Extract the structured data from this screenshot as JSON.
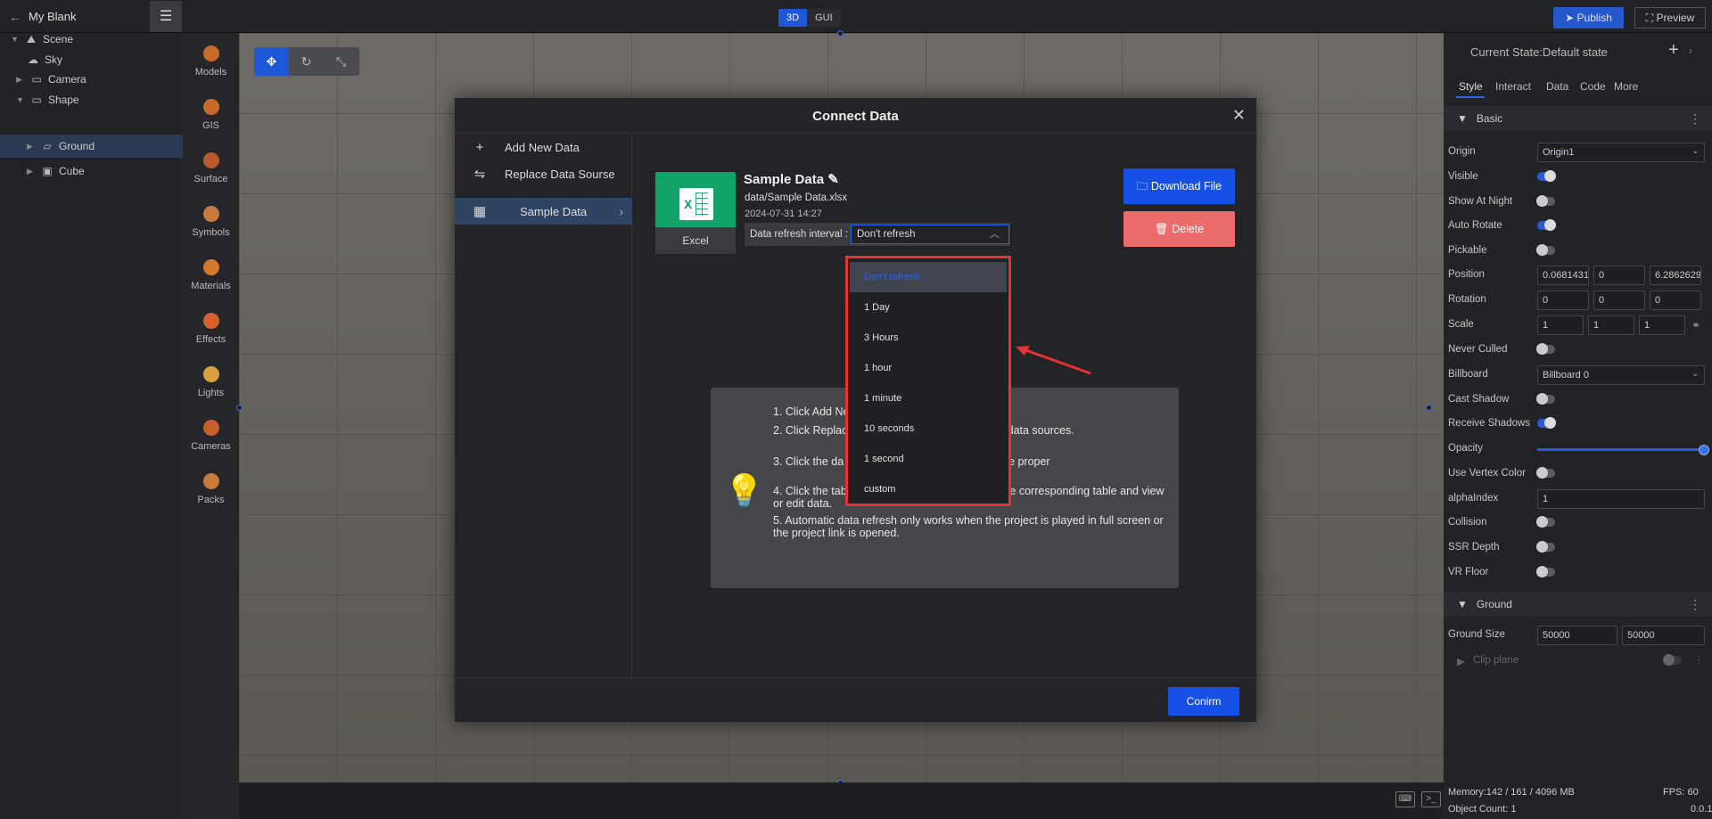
{
  "topbar": {
    "project_name": "My Blank",
    "modes": [
      "3D",
      "GUI"
    ],
    "publish_label": "Publish",
    "preview_label": "Preview"
  },
  "scene_tree": {
    "items": [
      {
        "label": "Scene"
      },
      {
        "label": "Sky"
      },
      {
        "label": "Camera"
      },
      {
        "label": "Shape"
      },
      {
        "label": "Ground"
      },
      {
        "label": "Cube"
      }
    ]
  },
  "toolbox": {
    "items": [
      {
        "label": "Models",
        "color": "#c86a2c"
      },
      {
        "label": "GIS",
        "color": "#c86a2c"
      },
      {
        "label": "Surface",
        "color": "#b85a2c"
      },
      {
        "label": "Symbols",
        "color": "#c87a3c"
      },
      {
        "label": "Materials",
        "color": "#d0782c"
      },
      {
        "label": "Effects",
        "color": "#d8602c"
      },
      {
        "label": "Lights",
        "color": "#d8a040"
      },
      {
        "label": "Cameras",
        "color": "#c8602c"
      },
      {
        "label": "Packs",
        "color": "#c87a3c"
      }
    ]
  },
  "properties": {
    "current_state": "Current State:Default state",
    "tabs": [
      "Style",
      "Interact",
      "Data",
      "Code",
      "More"
    ],
    "basic_title": "Basic",
    "rows": {
      "origin": {
        "label": "Origin",
        "value": "Origin1"
      },
      "visible": {
        "label": "Visible",
        "on": true
      },
      "show_at_night": {
        "label": "Show At Night",
        "on": false
      },
      "auto_rotate": {
        "label": "Auto Rotate",
        "on": true
      },
      "pickable": {
        "label": "Pickable",
        "on": false
      },
      "position": {
        "label": "Position",
        "values": [
          "0.0681431",
          "0",
          "6.28626291"
        ]
      },
      "rotation": {
        "label": "Rotation",
        "values": [
          "0",
          "0",
          "0"
        ]
      },
      "scale": {
        "label": "Scale",
        "values": [
          "1",
          "1",
          "1"
        ]
      },
      "never_culled": {
        "label": "Never Culled",
        "on": false
      },
      "billboard": {
        "label": "Billboard",
        "value": "Billboard 0"
      },
      "cast_shadow": {
        "label": "Cast Shadow",
        "on": false
      },
      "receive_shadows": {
        "label": "Receive Shadows",
        "on": true
      },
      "opacity": {
        "label": "Opacity",
        "value": 1.0
      },
      "use_vertex_color": {
        "label": "Use Vertex Color",
        "on": false
      },
      "alpha_index": {
        "label": "alphaIndex",
        "value": "1"
      },
      "collision": {
        "label": "Collision",
        "on": false
      },
      "ssr_depth": {
        "label": "SSR Depth",
        "on": false
      },
      "vr_floor": {
        "label": "VR Floor",
        "on": false
      }
    },
    "ground_title": "Ground",
    "ground_size": {
      "label": "Ground Size",
      "values": [
        "50000",
        "50000"
      ]
    },
    "clip_plane_label": "Clip plane"
  },
  "status": {
    "memory": "Memory:142 / 161 / 4096 MB",
    "fps": "FPS: 60",
    "object_count": "Object Count: 1",
    "version": "0.0.1"
  },
  "modal": {
    "title": "Connect Data",
    "left_items": [
      {
        "icon": "+",
        "label": "Add New Data"
      },
      {
        "icon": "⇋",
        "label": "Replace Data Sourse"
      },
      {
        "icon": "▦",
        "label": "Sample Data"
      }
    ],
    "excel_label": "Excel",
    "data_name": "Sample Data",
    "data_path": "data/Sample Data.xlsx",
    "data_date": "2024-07-31 14:27",
    "refresh_label": "Data refresh interval :",
    "refresh_value": "Don't refresh",
    "download_label": "Download File",
    "delete_label": "Delete",
    "confirm_label": "Conirm",
    "info_lines": [
      "1. Click Add Ne                                          a new data source",
      "2. Click Replac                                          t to replace the currently added data sources.",
      "3. Click the da                                          ew the corresponding data source proper",
      "4. Click the table name on the left to switch to the corresponding table and view or edit data.",
      "5. Automatic data refresh only works when the project is played in full screen or the project link is opened."
    ],
    "dropdown_options": [
      "Don't refresh",
      "1 Day",
      "3 Hours",
      "1 hour",
      "1 minute",
      "10 seconds",
      "1 second",
      "custom"
    ]
  },
  "colors": {
    "accent": "#1650e6",
    "delete": "#ec6c6c",
    "excel": "#12a36a",
    "highlight": "#e63232"
  }
}
